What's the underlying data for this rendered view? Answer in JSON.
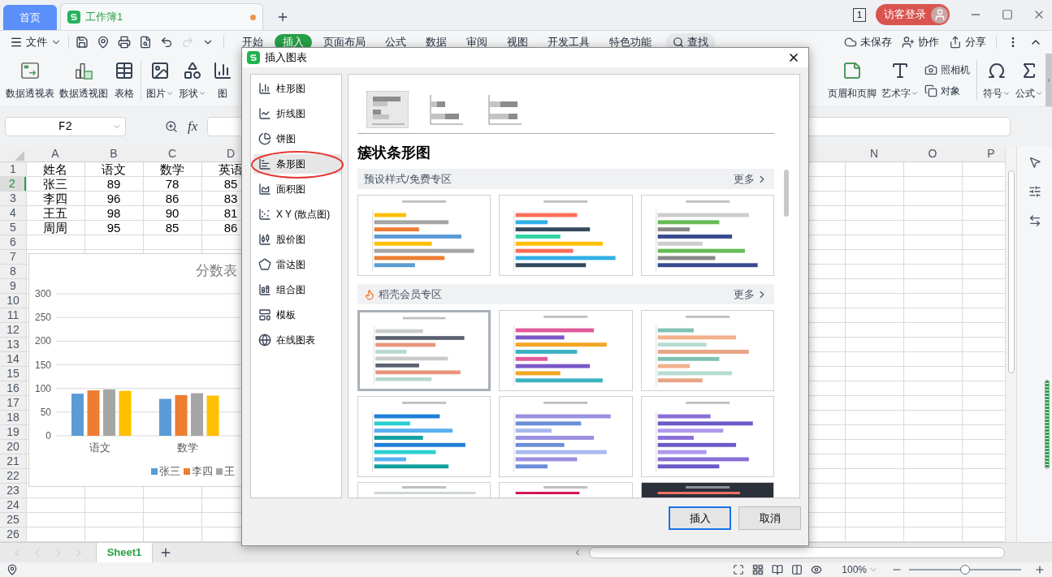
{
  "app_tabs": [
    {
      "label": "首页",
      "kind": "home",
      "selected": false
    },
    {
      "label": "工作簿1",
      "kind": "doc",
      "selected": true,
      "unsaved": true
    }
  ],
  "page_indicator": "1",
  "login_button": "访客登录",
  "file_menu": "文件",
  "ribbon_tabs": [
    {
      "label": "开始",
      "selected": false
    },
    {
      "label": "插入",
      "selected": true
    },
    {
      "label": "页面布局",
      "selected": false
    },
    {
      "label": "公式",
      "selected": false
    },
    {
      "label": "数据",
      "selected": false
    },
    {
      "label": "审阅",
      "selected": false
    },
    {
      "label": "视图",
      "selected": false
    },
    {
      "label": "开发工具",
      "selected": false
    },
    {
      "label": "特色功能",
      "selected": false
    }
  ],
  "search_tab": "查找",
  "actions": [
    "未保存",
    "协作",
    "分享"
  ],
  "ribbon_left": [
    {
      "label": "数据透视表",
      "dropdown": false
    },
    {
      "label": "数据透视图",
      "dropdown": false
    },
    {
      "label": "表格",
      "dropdown": false
    },
    {
      "label": "图片",
      "dropdown": true
    },
    {
      "label": "形状",
      "dropdown": true
    },
    {
      "label": "图"
    }
  ],
  "ribbon_right": [
    {
      "label": "页眉和页脚",
      "dropdown": false
    },
    {
      "label": "艺术字",
      "dropdown": true
    }
  ],
  "ribbon_small": [
    "照相机",
    "对象"
  ],
  "ribbon_far": [
    {
      "label": "符号",
      "dropdown": true
    },
    {
      "label": "公式",
      "dropdown": true
    }
  ],
  "name_box": "F2",
  "fx_label": "fx",
  "columns_left": [
    "A",
    "B",
    "C",
    "D"
  ],
  "columns_right": [
    "N",
    "O",
    "P"
  ],
  "rows": [
    {
      "header": "1",
      "selected": false,
      "cells": [
        "姓名",
        "语文",
        "数学",
        "英语"
      ]
    },
    {
      "header": "2",
      "selected": true,
      "cells": [
        "张三",
        "89",
        "78",
        "85"
      ]
    },
    {
      "header": "3",
      "selected": false,
      "cells": [
        "李四",
        "96",
        "86",
        "83"
      ]
    },
    {
      "header": "4",
      "selected": false,
      "cells": [
        "王五",
        "98",
        "90",
        "81"
      ]
    },
    {
      "header": "5",
      "selected": false,
      "cells": [
        "周周",
        "95",
        "85",
        "86"
      ]
    },
    {
      "header": "6",
      "selected": false
    },
    {
      "header": "7",
      "selected": false
    },
    {
      "header": "8",
      "selected": false
    },
    {
      "header": "9",
      "selected": false
    },
    {
      "header": "10",
      "selected": false
    },
    {
      "header": "11",
      "selected": false
    },
    {
      "header": "12",
      "selected": false
    },
    {
      "header": "13",
      "selected": false
    },
    {
      "header": "14",
      "selected": false
    },
    {
      "header": "15",
      "selected": false
    },
    {
      "header": "16",
      "selected": false
    },
    {
      "header": "17",
      "selected": false
    },
    {
      "header": "18",
      "selected": false
    },
    {
      "header": "19",
      "selected": false
    },
    {
      "header": "20",
      "selected": false
    },
    {
      "header": "21",
      "selected": false
    },
    {
      "header": "22",
      "selected": false
    },
    {
      "header": "23",
      "selected": false
    },
    {
      "header": "24",
      "selected": false
    },
    {
      "header": "25",
      "selected": false
    },
    {
      "header": "26",
      "selected": false
    }
  ],
  "chart": {
    "chart_data": {
      "type": "bar",
      "title": "分数表",
      "grid": true,
      "legend": true,
      "categories": [
        "语文",
        "数学"
      ],
      "ylim": [
        0,
        300
      ],
      "yticks": [
        0,
        50,
        100,
        150,
        200,
        250,
        300
      ],
      "series": [
        {
          "name": "张三",
          "color": "#5b9bd5",
          "values": [
            89,
            78
          ]
        },
        {
          "name": "李四",
          "color": "#ed7d31",
          "values": [
            96,
            86
          ]
        },
        {
          "name": "王",
          "color": "#a5a5a5",
          "values": [
            98,
            90
          ]
        },
        {
          "color": "#ffc000",
          "values": [
            95,
            85
          ]
        }
      ]
    }
  },
  "sheet_tabs": [
    {
      "label": "Sheet1",
      "selected": true
    }
  ],
  "zoom": "100%",
  "zoom_slider": {
    "level": 0.5
  },
  "dialog": {
    "title": "插入图表",
    "chart_types": [
      {
        "label": "柱形图",
        "selected": false
      },
      {
        "label": "折线图",
        "selected": false
      },
      {
        "label": "饼图",
        "selected": false
      },
      {
        "label": "条形图",
        "selected": true
      },
      {
        "label": "面积图",
        "selected": false
      },
      {
        "label": "X Y (散点图)",
        "selected": false
      },
      {
        "label": "股价图",
        "selected": false
      },
      {
        "label": "雷达图",
        "selected": false
      },
      {
        "label": "组合图",
        "selected": false
      },
      {
        "label": "模板",
        "selected": false
      },
      {
        "label": "在线图表",
        "selected": false
      }
    ],
    "subtypes": [
      {
        "selected": true
      },
      {
        "selected": false
      },
      {
        "selected": false
      }
    ],
    "heading": "簇状条形图",
    "sections": [
      {
        "title": "预设样式/免费专区",
        "kind": "free",
        "more": "更多",
        "cards": [
          {
            "dark": false,
            "selected": false
          },
          {
            "dark": false,
            "selected": false
          },
          {
            "dark": false,
            "selected": false
          }
        ]
      },
      {
        "title": "稻壳会员专区",
        "kind": "member",
        "more": "更多",
        "cards": [
          {
            "dark": false,
            "selected": true
          },
          {
            "dark": false,
            "selected": false
          },
          {
            "dark": false,
            "selected": false
          },
          {
            "dark": false,
            "selected": false
          },
          {
            "dark": false,
            "selected": false
          },
          {
            "dark": false,
            "selected": false
          },
          {
            "dark": false,
            "selected": false
          },
          {
            "dark": false,
            "selected": false
          },
          {
            "dark": true,
            "selected": false
          }
        ]
      }
    ],
    "buttons": [
      {
        "label": "插入",
        "primary": true
      },
      {
        "label": "取消",
        "primary": false
      }
    ]
  }
}
